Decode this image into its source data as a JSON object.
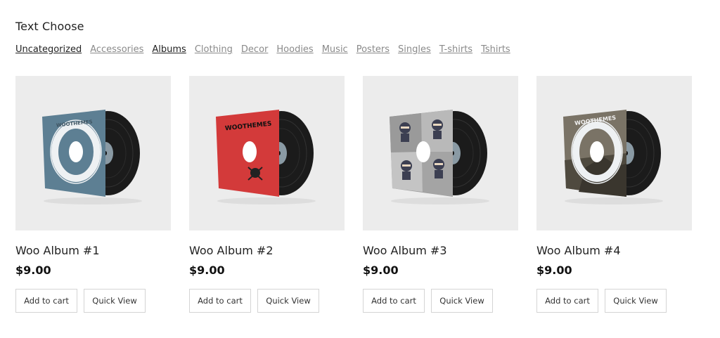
{
  "heading": "Text Choose",
  "filters": [
    {
      "label": "Uncategorized",
      "style": "dark"
    },
    {
      "label": "Accessories",
      "style": "light"
    },
    {
      "label": "Albums",
      "style": "dark"
    },
    {
      "label": "Clothing",
      "style": "light"
    },
    {
      "label": "Decor",
      "style": "light"
    },
    {
      "label": "Hoodies",
      "style": "light"
    },
    {
      "label": "Music",
      "style": "light"
    },
    {
      "label": "Posters",
      "style": "light"
    },
    {
      "label": "Singles",
      "style": "light"
    },
    {
      "label": "T-shirts",
      "style": "light"
    },
    {
      "label": "Tshirts",
      "style": "light"
    }
  ],
  "products": [
    {
      "title": "Woo Album #1",
      "price": "$9.00",
      "cart_label": "Add to cart",
      "quickview_label": "Quick View",
      "sleeve_color": "#5d7f93",
      "art": "ring",
      "art_text": "WOOTHEMES"
    },
    {
      "title": "Woo Album #2",
      "price": "$9.00",
      "cart_label": "Add to cart",
      "quickview_label": "Quick View",
      "sleeve_color": "#d33a3a",
      "art": "logo",
      "art_text": "WOOTHEMES"
    },
    {
      "title": "Woo Album #3",
      "price": "$9.00",
      "cart_label": "Add to cart",
      "quickview_label": "Quick View",
      "sleeve_color": "#9e9e9e",
      "art": "ninjas",
      "art_text": ""
    },
    {
      "title": "Woo Album #4",
      "price": "$9.00",
      "cart_label": "Add to cart",
      "quickview_label": "Quick View",
      "sleeve_color": "#7a7366",
      "art": "photo",
      "art_text": "WOOTHEMES"
    }
  ]
}
